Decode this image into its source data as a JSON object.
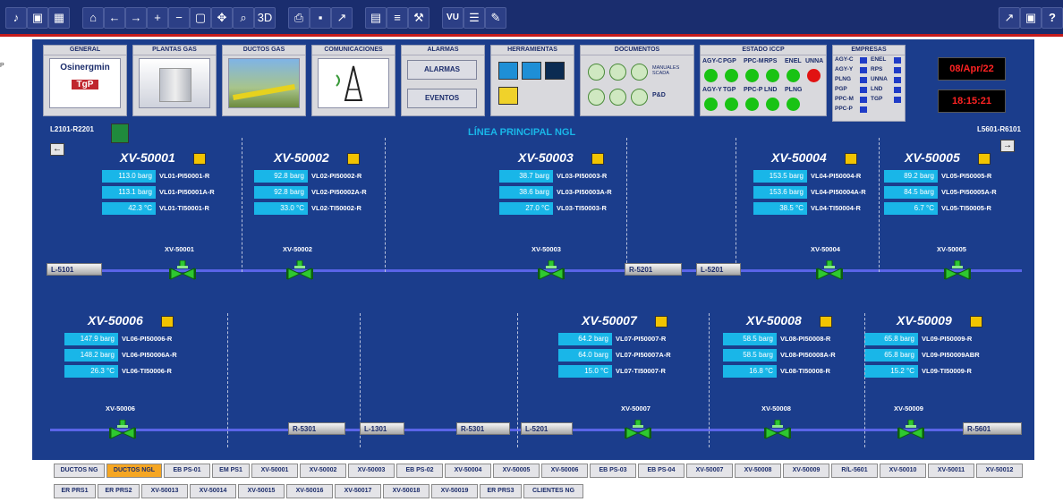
{
  "toolbar": {
    "icons_left": [
      "bell-icon",
      "screen-icon",
      "grid-icon",
      "home-icon",
      "back-icon",
      "forward-icon",
      "zoom-in-icon",
      "zoom-out-icon",
      "fit-icon",
      "pan-icon",
      "search-icon",
      "3d-icon",
      "print-icon",
      "save-icon",
      "chart-icon",
      "db-icon",
      "report-icon",
      "tool-icon",
      "vu-icon",
      "list-icon",
      "pen-icon"
    ],
    "icons_right": [
      "trend-icon",
      "users-icon",
      "help-icon"
    ],
    "vu_label": "VU",
    "help_label": "?"
  },
  "left_marker": "P",
  "header": {
    "general": {
      "title": "GENERAL",
      "logo_text": "Osinergmin",
      "logo_sub": "TgP"
    },
    "plantas": {
      "title": "PLANTAS GAS"
    },
    "ductos": {
      "title": "DUCTOS GAS"
    },
    "comunicaciones": {
      "title": "COMUNICACIONES"
    },
    "alarmas": {
      "title": "ALARMAS",
      "btn_alarmas": "ALARMAS",
      "btn_eventos": "EVENTOS"
    },
    "herramientas": {
      "title": "HERRAMIENTAS"
    },
    "documentos": {
      "title": "DOCUMENTOS",
      "manuales": "MANUALES SCADA",
      "pid": "P&D"
    },
    "iccp": {
      "title": "ESTADO ICCP",
      "row1": [
        "AGY-C",
        "PGP",
        "PPC-M",
        "RPS",
        "ENEL",
        "UNNA"
      ],
      "row2": [
        "AGY-Y",
        "TGP",
        "PPC-P",
        "LND",
        "PLNG"
      ]
    },
    "empresas": {
      "title": "EMPRESAS",
      "col1": [
        "AGY-C",
        "AGY-Y",
        "PLNG",
        "PGP",
        "PPC-M",
        "PPC-P"
      ],
      "col2": [
        "ENEL",
        "RPS",
        "UNNA",
        "LND",
        "TGP"
      ]
    },
    "date": "08/Apr/22",
    "time": "18:15:21"
  },
  "section_left": "L2101-R2201",
  "section_right": "L5601-R6101",
  "main_title": "LÍNEA PRINCIPAL NGL",
  "valves_top": [
    {
      "name": "XV-50001",
      "label": "XV-50001",
      "rows": [
        [
          "113.0",
          "barg",
          "VL01-PI50001-R"
        ],
        [
          "113.1",
          "barg",
          "VL01-PI50001A-R"
        ],
        [
          "42.3",
          "°C",
          "VL01-TI50001-R"
        ]
      ]
    },
    {
      "name": "XV-50002",
      "label": "XV-50002",
      "rows": [
        [
          "92.8",
          "barg",
          "VL02-PI50002-R"
        ],
        [
          "92.8",
          "barg",
          "VL02-PI50002A-R"
        ],
        [
          "33.0",
          "°C",
          "VL02-TI50002-R"
        ]
      ]
    },
    {
      "name": "XV-50003",
      "label": "XV-50003",
      "rows": [
        [
          "38.7",
          "barg",
          "VL03-PI50003-R"
        ],
        [
          "38.6",
          "barg",
          "VL03-PI50003A-R"
        ],
        [
          "27.0",
          "°C",
          "VL03-TI50003-R"
        ]
      ]
    },
    {
      "name": "XV-50004",
      "label": "XV-50004",
      "rows": [
        [
          "153.5",
          "barg",
          "VL04-PI50004-R"
        ],
        [
          "153.6",
          "barg",
          "VL04-PI50004A-R"
        ],
        [
          "38.5",
          "°C",
          "VL04-TI50004-R"
        ]
      ]
    },
    {
      "name": "XV-50005",
      "label": "XV-50005",
      "rows": [
        [
          "89.2",
          "barg",
          "VL05-PI50005-R"
        ],
        [
          "84.5",
          "barg",
          "VL05-PI50005A-R"
        ],
        [
          "6.7",
          "°C",
          "VL05-TI50005-R"
        ]
      ]
    }
  ],
  "valves_bottom": [
    {
      "name": "XV-50006",
      "label": "XV-50006",
      "rows": [
        [
          "147.9",
          "barg",
          "VL06-PI50006-R"
        ],
        [
          "148.2",
          "barg",
          "VL06-PI50006A-R"
        ],
        [
          "26.3",
          "°C",
          "VL06-TI50006-R"
        ]
      ]
    },
    {
      "name": "XV-50007",
      "label": "XV-50007",
      "rows": [
        [
          "64.2",
          "barg",
          "VL07-PI50007-R"
        ],
        [
          "64.0",
          "barg",
          "VL07-PI50007A-R"
        ],
        [
          "15.0",
          "°C",
          "VL07-TI50007-R"
        ]
      ]
    },
    {
      "name": "XV-50008",
      "label": "XV-50008",
      "rows": [
        [
          "58.5",
          "barg",
          "VL08-PI50008-R"
        ],
        [
          "58.5",
          "barg",
          "VL08-PI50008A-R"
        ],
        [
          "16.8",
          "°C",
          "VL08-TI50008-R"
        ]
      ]
    },
    {
      "name": "XV-50009",
      "label": "XV-50009",
      "rows": [
        [
          "65.8",
          "barg",
          "VL09-PI50009-R"
        ],
        [
          "65.8",
          "barg",
          "VL09-PI50009ABR"
        ],
        [
          "15.2",
          "°C",
          "VL09-TI50009-R"
        ]
      ]
    }
  ],
  "connectors_top": [
    "L-5101",
    "R-5201",
    "L-5201"
  ],
  "connectors_bottom": [
    "R-5301",
    "L-1301",
    "R-5301",
    "L-5201",
    "R-5601"
  ],
  "nav_row1": [
    "DUCTOS NG",
    "DUCTOS NGL",
    "EB PS-01",
    "EM PS1",
    "XV-50001",
    "XV-50002",
    "XV-50003",
    "EB PS-02",
    "XV-50004",
    "XV-50005",
    "XV-50006",
    "EB PS-03",
    "EB PS-04",
    "XV-50007",
    "XV-50008",
    "XV-50009",
    "R/L-5601",
    "XV-50010",
    "XV-50011",
    "XV-50012"
  ],
  "nav_row2": [
    "ER PRS1",
    "ER PRS2",
    "XV-50013",
    "XV-50014",
    "XV-50015",
    "XV-50016",
    "XV-50017",
    "XV-50018",
    "XV-50019",
    "ER PRS3",
    "CLIENTES NG"
  ],
  "nav_active": "DUCTOS NGL",
  "colors": {
    "panel": "#1b3d8c",
    "value_box": "#19b6e8",
    "pipe": "#5a64e8",
    "valve": "#2ec830",
    "active_nav": "#f5a623",
    "clock_text": "#ff2323"
  }
}
